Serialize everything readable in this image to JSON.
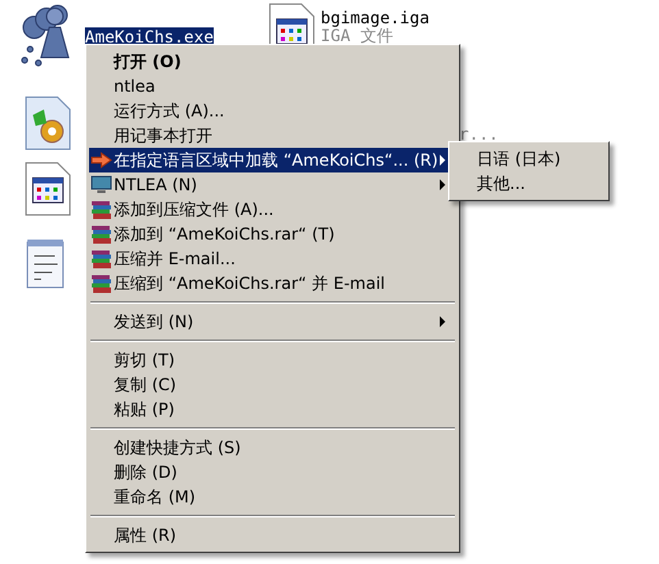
{
  "desktop": {
    "icons": [
      {
        "kind": "figure",
        "label": "AmeKoiChs.exe",
        "selected": true
      },
      {
        "kind": "window",
        "label": "bgimage.iga",
        "sublabel": "IGA 文件",
        "selected": false
      },
      {
        "kind": "gear"
      },
      {
        "kind": "window"
      },
      {
        "kind": "notepad"
      }
    ],
    "fragment": "r..."
  },
  "menu": {
    "items": [
      {
        "kind": "item",
        "label": "打开 (O)",
        "bold": true,
        "selected": false
      },
      {
        "kind": "item",
        "label": "ntlea",
        "selected": false
      },
      {
        "kind": "item",
        "label": "运行方式 (A)...",
        "selected": false
      },
      {
        "kind": "item",
        "label": "用记事本打开",
        "selected": false
      },
      {
        "kind": "arrow",
        "label": "在指定语言区域中加载 “AmeKoiChs“... (R)",
        "submenu": true,
        "selected": true
      },
      {
        "kind": "monitor",
        "label": "NTLEA  (N)",
        "submenu": true,
        "selected": false
      },
      {
        "kind": "archive",
        "label": "添加到压缩文件 (A)...",
        "selected": false
      },
      {
        "kind": "archive",
        "label": "添加到 “AmeKoiChs.rar“ (T)",
        "selected": false
      },
      {
        "kind": "archive",
        "label": "压缩并 E-mail...",
        "selected": false
      },
      {
        "kind": "archive",
        "label": "压缩到 “AmeKoiChs.rar“ 并 E-mail",
        "selected": false
      },
      {
        "kind": "separator"
      },
      {
        "kind": "item",
        "label": "发送到 (N)",
        "submenu": true,
        "selected": false
      },
      {
        "kind": "separator"
      },
      {
        "kind": "item",
        "label": "剪切 (T)",
        "selected": false
      },
      {
        "kind": "item",
        "label": "复制 (C)",
        "selected": false
      },
      {
        "kind": "item",
        "label": "粘贴 (P)",
        "selected": false
      },
      {
        "kind": "separator"
      },
      {
        "kind": "item",
        "label": "创建快捷方式 (S)",
        "selected": false
      },
      {
        "kind": "item",
        "label": "删除 (D)",
        "selected": false
      },
      {
        "kind": "item",
        "label": "重命名 (M)",
        "selected": false
      },
      {
        "kind": "separator"
      },
      {
        "kind": "item",
        "label": "属性 (R)",
        "selected": false
      }
    ]
  },
  "submenu": {
    "items": [
      {
        "label": "日语 (日本)"
      },
      {
        "label": "其他..."
      }
    ]
  }
}
